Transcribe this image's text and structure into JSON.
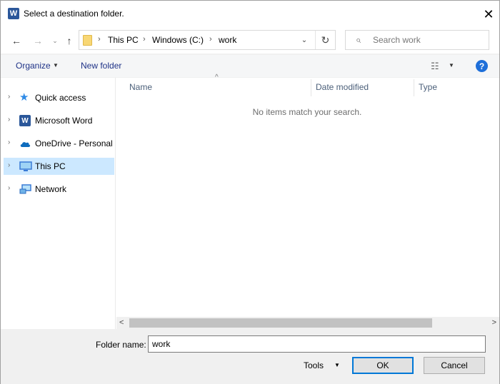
{
  "window": {
    "title": "Select a destination folder.",
    "app_icon": "W",
    "close_glyph": "✕"
  },
  "navbar": {
    "back_glyph": "←",
    "forward_glyph": "→",
    "recent_glyph": "⌄",
    "up_glyph": "↑",
    "breadcrumb": [
      "This PC",
      "Windows (C:)",
      "work"
    ],
    "separator": "›",
    "dropdown_glyph": "⌄",
    "refresh_glyph": "↻",
    "search_placeholder": "Search work",
    "search_icon": "⌕"
  },
  "commandbar": {
    "organize_label": "Organize",
    "new_folder_label": "New folder",
    "dropdown_glyph": "▼",
    "view_icon": "☷",
    "help_glyph": "?"
  },
  "sidebar": {
    "chevron": "›",
    "items": [
      {
        "label": "Quick access",
        "icon": "star-icon",
        "selected": false
      },
      {
        "label": "Microsoft Word",
        "icon": "word-icon",
        "selected": false
      },
      {
        "label": "OneDrive - Personal",
        "icon": "cloud-icon",
        "selected": false
      },
      {
        "label": "This PC",
        "icon": "computer-icon",
        "selected": true
      },
      {
        "label": "Network",
        "icon": "network-icon",
        "selected": false
      }
    ]
  },
  "filelist": {
    "sort_caret": "^",
    "columns": [
      "Name",
      "Date modified",
      "Type"
    ],
    "empty_message": "No items match your search.",
    "scroll_left": "<",
    "scroll_right": ">"
  },
  "footer": {
    "folder_name_label": "Folder name:",
    "folder_name_value": "work",
    "tools_label": "Tools",
    "tools_arrow": "▼",
    "ok_label": "OK",
    "cancel_label": "Cancel"
  },
  "colors": {
    "selection": "#cce8ff",
    "link_text": "#1e3287",
    "help_blue": "#1e6fd9",
    "word_blue": "#2b579a"
  }
}
